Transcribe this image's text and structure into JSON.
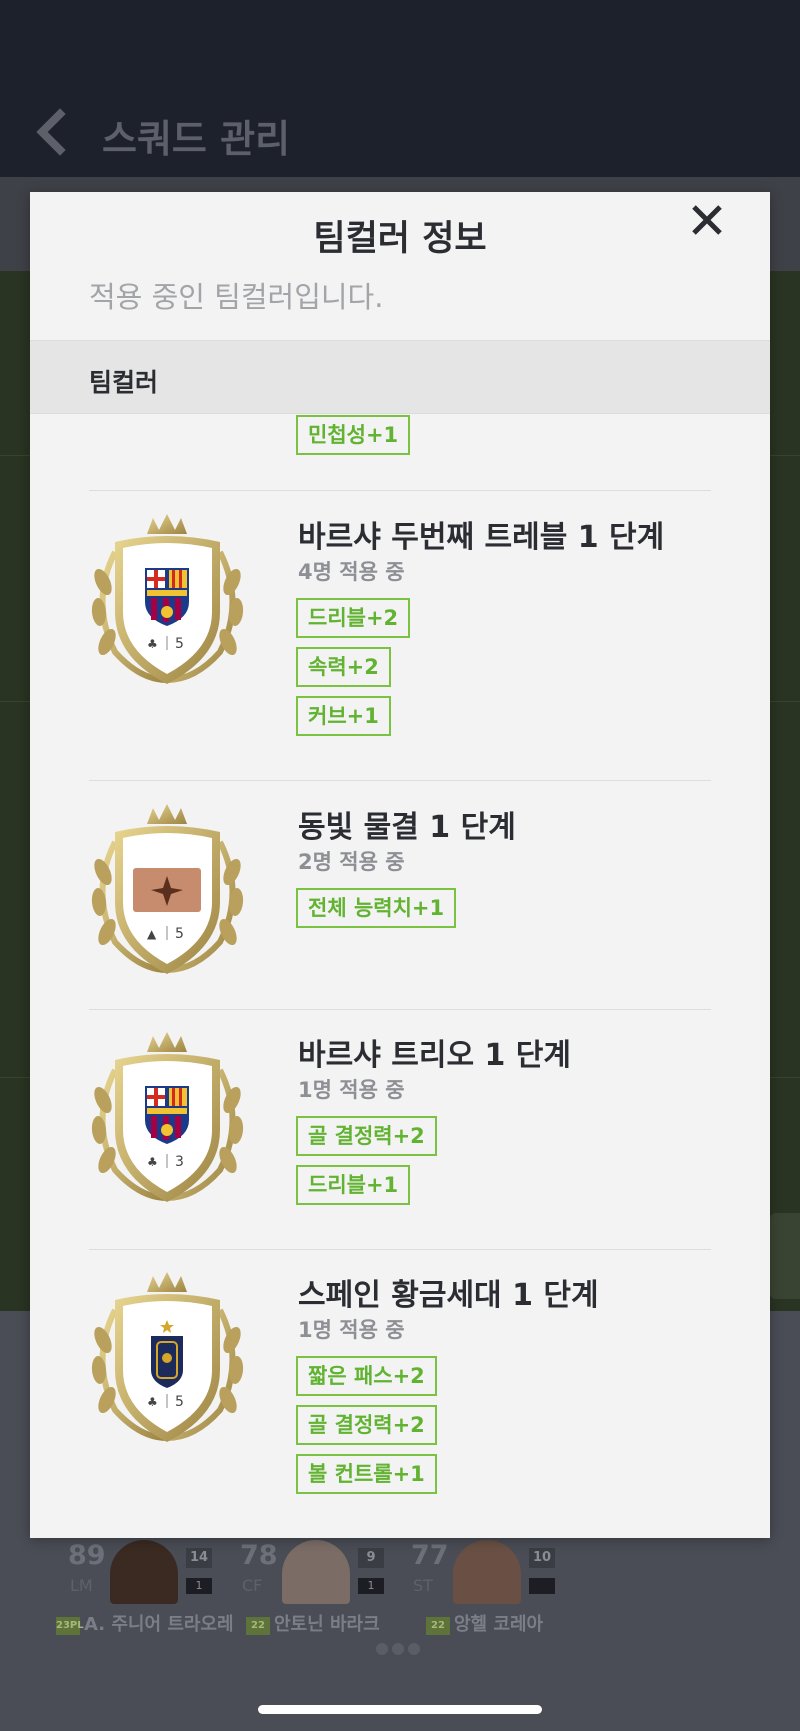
{
  "background": {
    "title": "스쿼드 관리",
    "players": [
      {
        "ovr": "89",
        "pos": "LM",
        "number": "14",
        "level": "1",
        "tag": "23PL",
        "name": "A. 주니어 트라오레"
      },
      {
        "ovr": "78",
        "pos": "CF",
        "number": "9",
        "level": "1",
        "tag": "22",
        "name": "안토닌 바라크"
      },
      {
        "ovr": "77",
        "pos": "ST",
        "number": "10",
        "level": "",
        "tag": "22",
        "name": "앙헬 코레아"
      }
    ]
  },
  "modal": {
    "title": "팀컬러 정보",
    "subtitle": "적용 중인 팀컬러입니다.",
    "section_label": "팀컬러",
    "partial_stat": "민첩성+1",
    "entries": [
      {
        "name": "바르샤 두번째 트레블 1 단계",
        "count": "4명 적용 중",
        "badge_icon": "fc-barcelona-crest-icon",
        "badge_number": "5",
        "stats": [
          "드리블+2",
          "속력+2",
          "커브+1"
        ]
      },
      {
        "name": "동빛 물결 1 단계",
        "count": "2명 적용 중",
        "badge_icon": "bronze-card-icon",
        "badge_number": "5",
        "stats": [
          "전체 능력치+1"
        ]
      },
      {
        "name": "바르샤 트리오 1 단계",
        "count": "1명 적용 중",
        "badge_icon": "fc-barcelona-crest-icon",
        "badge_number": "3",
        "stats": [
          "골 결정력+2",
          "드리블+1"
        ]
      },
      {
        "name": "스페인 황금세대 1 단계",
        "count": "1명 적용 중",
        "badge_icon": "spain-crest-icon",
        "badge_number": "5",
        "stats": [
          "짧은 패스+2",
          "골 결정력+2",
          "볼 컨트롤+1"
        ]
      }
    ]
  },
  "colors": {
    "accent_green": "#7cc242",
    "header_dark": "#1d212c",
    "pitch": "#2a3422"
  }
}
